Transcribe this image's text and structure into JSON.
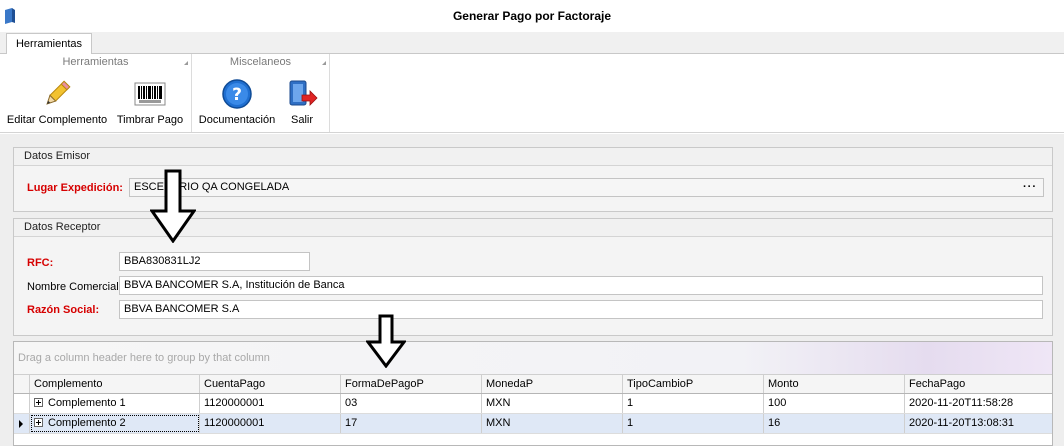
{
  "window": {
    "title": "Generar Pago por Factoraje"
  },
  "ribbon": {
    "tab": "Herramientas",
    "groups": [
      {
        "caption": "Herramientas",
        "buttons": [
          {
            "label": "Editar Complemento",
            "icon": "pencil-icon"
          },
          {
            "label": "Timbrar Pago",
            "icon": "barcode-icon"
          }
        ]
      },
      {
        "caption": "Miscelaneos",
        "buttons": [
          {
            "label": "Documentación",
            "icon": "help-icon"
          },
          {
            "label": "Salir",
            "icon": "exit-icon"
          }
        ]
      }
    ]
  },
  "emisor": {
    "title": "Datos Emisor",
    "lugar_label": "Lugar Expedición:",
    "lugar_value": "ESCENARIO QA CONGELADA",
    "lugar_button": "···"
  },
  "receptor": {
    "title": "Datos Receptor",
    "rfc_label": "RFC:",
    "rfc_value": "BBA830831LJ2",
    "nombre_label": "Nombre Comercial:",
    "nombre_value": "BBVA BANCOMER S.A, Institución de Banca",
    "razon_label": "Razón Social:",
    "razon_value": "BBVA BANCOMER S.A"
  },
  "grid": {
    "group_hint": "Drag a column header here to group by that column",
    "columns": [
      "Complemento",
      "CuentaPago",
      "FormaDePagoP",
      "MonedaP",
      "TipoCambioP",
      "Monto",
      "FechaPago"
    ],
    "rows": [
      [
        "Complemento 1",
        "1120000001",
        "03",
        "MXN",
        "1",
        "100",
        "2020-11-20T11:58:28"
      ],
      [
        "Complemento 2",
        "1120000001",
        "17",
        "MXN",
        "1",
        "16",
        "2020-11-20T13:08:31"
      ]
    ],
    "focused_row": 1
  },
  "colors": {
    "required_label": "#d60000",
    "focused_row": "#dfe8f6"
  }
}
